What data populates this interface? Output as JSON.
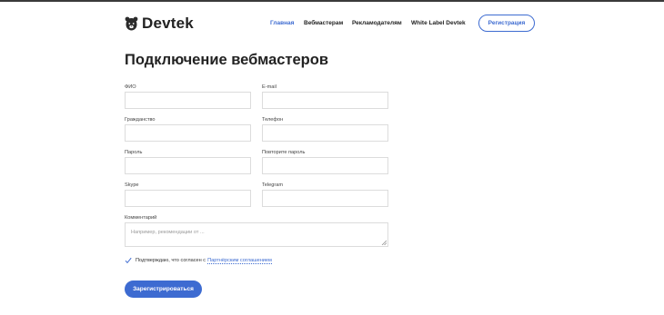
{
  "header": {
    "logo_text": "Devtek",
    "nav": [
      "Главная",
      "Вебмастерам",
      "Рекламодателям",
      "White Label Devtek"
    ],
    "register_button": "Регистрация"
  },
  "form": {
    "title": "Подключение вебмастеров",
    "fields": {
      "fio": "ФИО",
      "email": "E-mail",
      "citizenship": "Гражданство",
      "phone": "Телефон",
      "password": "Пароль",
      "password_repeat": "Повторите пароль",
      "skype": "Skype",
      "telegram": "Telegram",
      "comment": "Комментарий"
    },
    "comment_placeholder": "Например, рекомендации от ...",
    "agree_text": "Подтверждаю, что согласен с",
    "agree_link": "Партнёрским соглашением",
    "submit": "Зарегистрироваться"
  },
  "colors": {
    "accent": "#3d6bd1"
  }
}
